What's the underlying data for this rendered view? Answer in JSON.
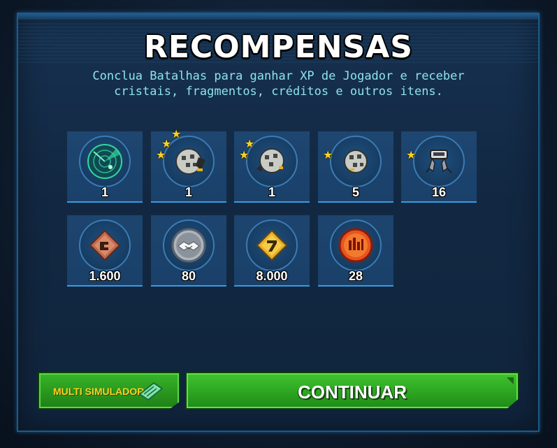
{
  "title": "RECOMPENSAS",
  "subtitle": {
    "line1": "Conclua Batalhas para ganhar XP de Jogador e receber",
    "line2": "cristais, fragmentos, créditos e outros itens."
  },
  "rewards": [
    {
      "icon": "radar-icon",
      "count": "1",
      "stars": 0
    },
    {
      "icon": "ability-material-icon",
      "count": "1",
      "stars": 3
    },
    {
      "icon": "ability-material-icon",
      "count": "1",
      "stars": 2
    },
    {
      "icon": "ability-material-icon",
      "count": "5",
      "stars": 1
    },
    {
      "icon": "salvage-droid-icon",
      "count": "16",
      "stars": 1
    },
    {
      "icon": "bronze-training-droid-icon",
      "count": "1.600",
      "stars": 0
    },
    {
      "icon": "guild-handshake-icon",
      "count": "80",
      "stars": 0
    },
    {
      "icon": "gold-training-droid-icon",
      "count": "8.000",
      "stars": 0
    },
    {
      "icon": "red-currency-icon",
      "count": "28",
      "stars": 0
    }
  ],
  "buttons": {
    "multi_sim": "MULTI SIMULADOR",
    "continue": "CONTINUAR"
  },
  "colors": {
    "accent": "#3a9be0",
    "subtitle": "#8fe3ee",
    "button_green": "#2ea822",
    "multi_label": "#ffd21f",
    "star": "#f5d327"
  }
}
